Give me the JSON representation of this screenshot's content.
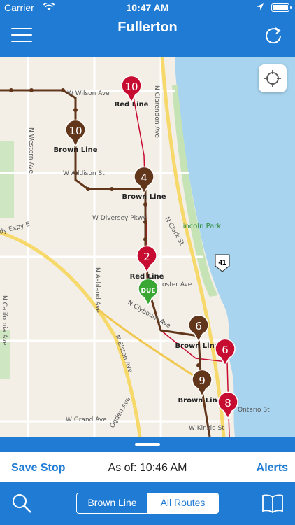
{
  "status": {
    "carrier": "Carrier",
    "time": "10:47 AM"
  },
  "header": {
    "title": "Fullerton"
  },
  "map": {
    "pins": [
      {
        "count": "10",
        "line": "Red Line"
      },
      {
        "count": "10",
        "line": "Brown Line"
      },
      {
        "count": "4",
        "line": "Brown Line"
      },
      {
        "count": "2",
        "line": "Red Line"
      },
      {
        "count": "DUE",
        "line": ""
      },
      {
        "count": "6",
        "line": "Brown Line"
      },
      {
        "count": "6",
        "line": ""
      },
      {
        "count": "9",
        "line": "Brown Line"
      },
      {
        "count": "8",
        "line": ""
      }
    ],
    "streets": [
      "W Wilson Ave",
      "N Clarendon Ave",
      "N Western Ave",
      "W Addison St",
      "N Clark St",
      "W Diversey Pkwy",
      "N Ashland Ave",
      "N Clybourn Ave",
      "N California Ave",
      "N Elston Ave",
      "W Grand Ave",
      "Ogden Ave",
      "W Kinzie St",
      "Ontario St",
      "oster Ave",
      "dy Expy E"
    ],
    "parks": [
      "Lincoln Park"
    ],
    "shield": "41",
    "colors": {
      "red_line": "#c60c30",
      "brown_line": "#62361b",
      "due": "#3aa735",
      "water": "#a8d4ef"
    }
  },
  "info": {
    "save_label": "Save Stop",
    "as_of": "As of: 10:46 AM",
    "alerts_label": "Alerts"
  },
  "tabs": {
    "brown": "Brown Line",
    "all": "All Routes"
  }
}
